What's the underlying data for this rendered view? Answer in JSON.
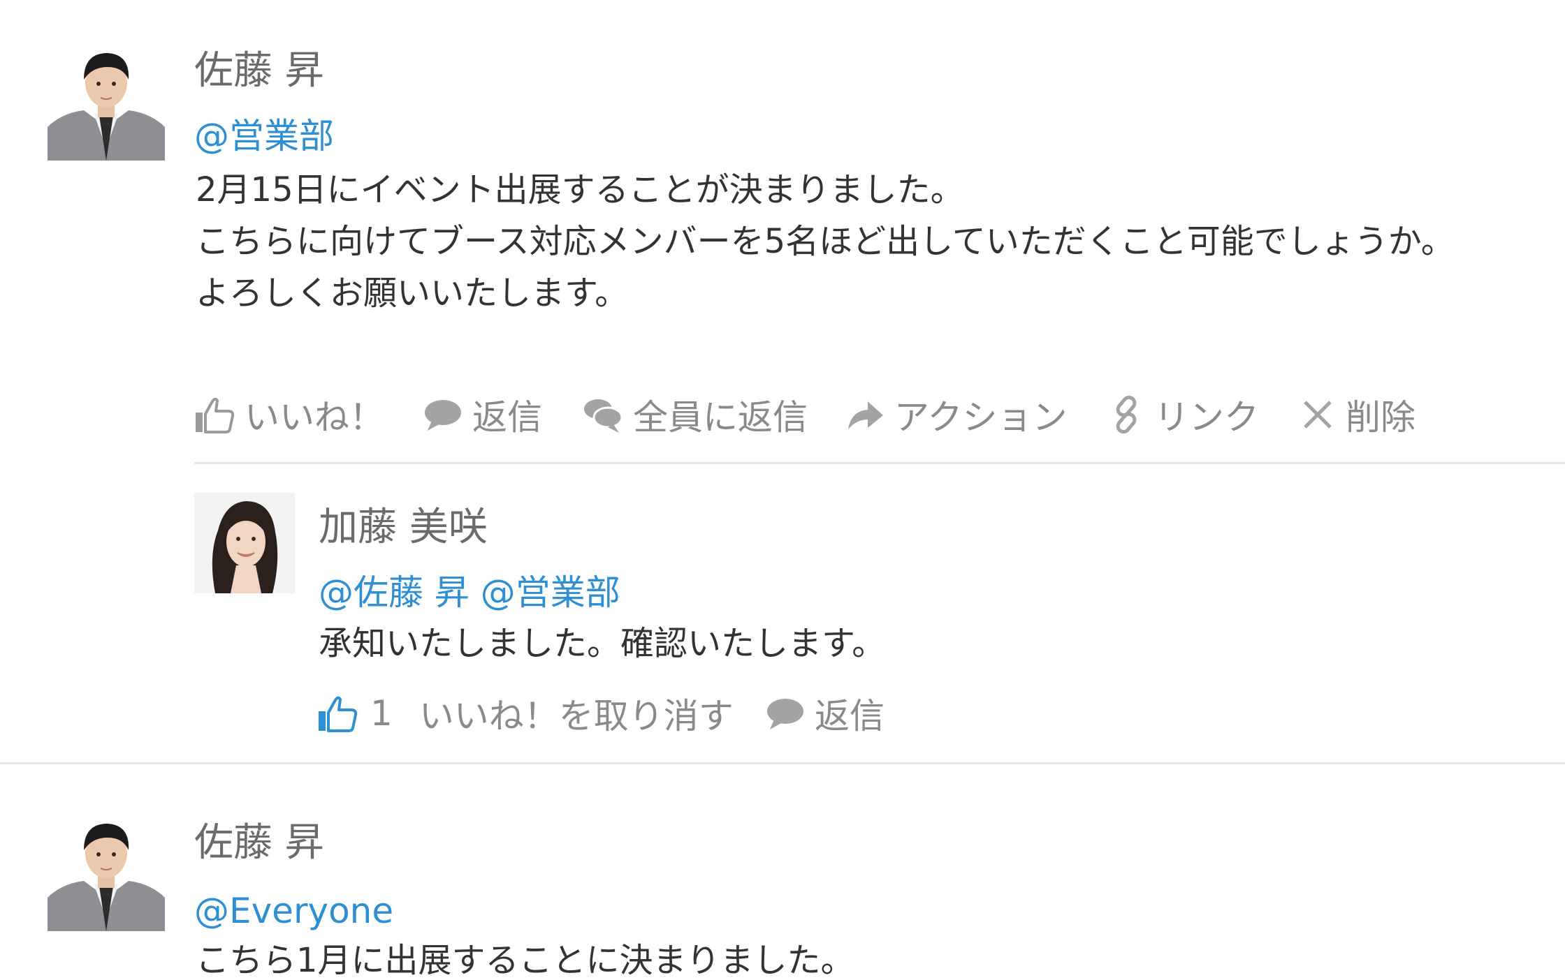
{
  "posts": [
    {
      "author": "佐藤 昇",
      "mention": "@営業部",
      "lines": [
        "2月15日にイベント出展することが決まりました。",
        "こちらに向けてブース対応メンバーを5名ほど出していただくこと可能でしょうか。",
        "よろしくお願いいたします。"
      ],
      "actions": {
        "like": "いいね！",
        "reply": "返信",
        "reply_all": "全員に返信",
        "action": "アクション",
        "link": "リンク",
        "delete": "削除"
      },
      "comment": {
        "author": "加藤 美咲",
        "mention": "@佐藤 昇 @営業部",
        "text": "承知いたしました。確認いたします。",
        "like_count": "1",
        "unlike": "いいね！を取り消す",
        "reply": "返信"
      }
    },
    {
      "author": "佐藤 昇",
      "mention": "@Everyone",
      "lines": [
        "こちら1月に出展することに決まりました。"
      ]
    }
  ],
  "colors": {
    "link": "#2f8fd3",
    "muted": "#8a8a8a",
    "text": "#333333",
    "divider": "#e6e6e6"
  },
  "icons": {
    "like": "thumbs-up-icon",
    "reply": "speech-bubble-icon",
    "reply_all": "double-speech-bubble-icon",
    "action": "share-arrow-icon",
    "link": "chain-link-icon",
    "delete": "close-x-icon"
  }
}
